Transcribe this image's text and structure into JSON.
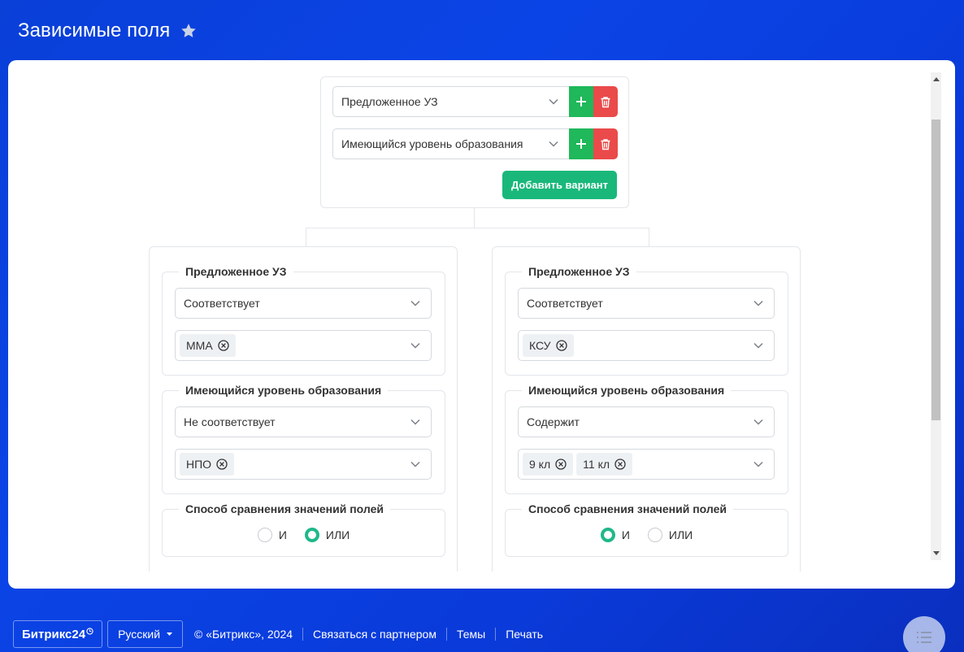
{
  "header": {
    "title": "Зависимые поля",
    "favorite_icon": "star-icon"
  },
  "top_box": {
    "rows": [
      {
        "value": "Предложенное УЗ"
      },
      {
        "value": "Имеющийся уровень образования"
      }
    ],
    "add_variant_label": "Добавить вариант"
  },
  "branches": [
    {
      "fields": [
        {
          "legend": "Предложенное УЗ",
          "condition": "Соответствует",
          "tags": [
            "ММА"
          ]
        },
        {
          "legend": "Имеющийся уровень образования",
          "condition": "Не соответствует",
          "tags": [
            "НПО"
          ]
        }
      ],
      "compare": {
        "legend": "Способ сравнения значений полей",
        "options": [
          "И",
          "ИЛИ"
        ],
        "selected": "ИЛИ"
      }
    },
    {
      "fields": [
        {
          "legend": "Предложенное УЗ",
          "condition": "Соответствует",
          "tags": [
            "КСУ"
          ]
        },
        {
          "legend": "Имеющийся уровень образования",
          "condition": "Содержит",
          "tags": [
            "9 кл",
            "11 кл"
          ]
        }
      ],
      "compare": {
        "legend": "Способ сравнения значений полей",
        "options": [
          "И",
          "ИЛИ"
        ],
        "selected": "И"
      }
    }
  ],
  "footer": {
    "logo": "Битрикс24",
    "language": "Русский",
    "copyright": "© «Битрикс», 2024",
    "links": [
      "Связаться с партнером",
      "Темы",
      "Печать"
    ]
  },
  "colors": {
    "add": "#1fb85a",
    "delete": "#ea4a4a",
    "accent": "#19b87a",
    "background": "#0b44e6"
  }
}
